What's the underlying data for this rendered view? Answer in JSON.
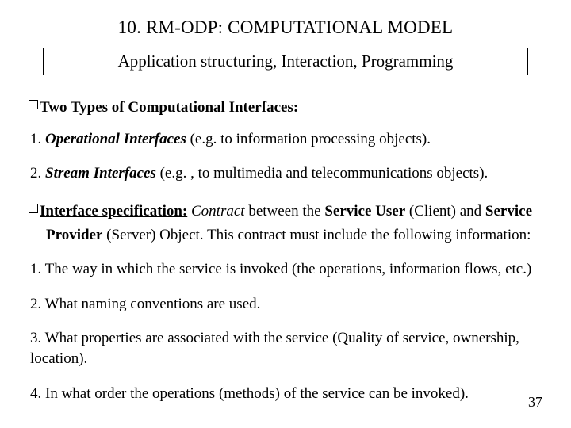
{
  "title": "10. RM-ODP: COMPUTATIONAL MODEL",
  "subtitle": "Application structuring, Interaction, Programming",
  "section1_heading": "Two Types of Computational Interfaces:",
  "item1_num": "1. ",
  "item1_term": "Operational Interfaces",
  "item1_rest": " (e.g. to information processing objects).",
  "item2_num": "2. ",
  "item2_term": "Stream Interfaces",
  "item2_rest": " (e.g. , to multimedia and telecommunications objects).",
  "spec_heading": "Interface specification:",
  "spec_space": " ",
  "spec_contract": "Contract",
  "spec_mid1": " between the ",
  "spec_su": "Service User",
  "spec_mid2": " (Client) and ",
  "spec_sp": "Service",
  "spec_provider": "Provider",
  "spec_tail": " (Server) Object. This contract must include the following information:",
  "c1": "1. The way in which the service is invoked (the operations, information flows, etc.)",
  "c2": "2. What naming conventions are used.",
  "c3": "3. What properties are associated with the service (Quality of service, ownership, location).",
  "c4": "4. In what order the operations (methods) of the service can be invoked).",
  "page": "37"
}
